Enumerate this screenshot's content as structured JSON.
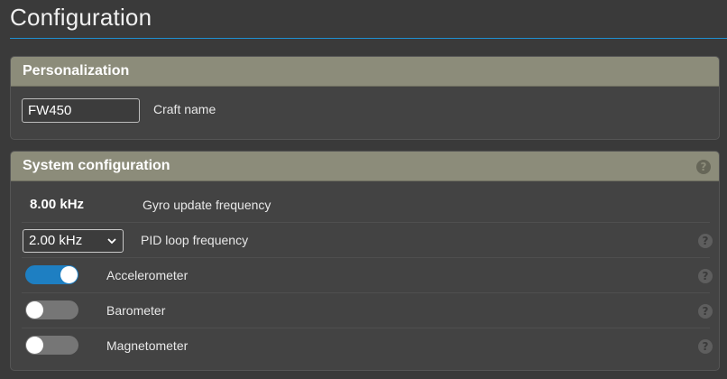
{
  "page": {
    "title": "Configuration"
  },
  "personalization": {
    "header": "Personalization",
    "craft_name_value": "FW450",
    "craft_name_label": "Craft name"
  },
  "system": {
    "header": "System configuration",
    "help_glyph": "?",
    "gyro": {
      "value": "8.00 kHz",
      "label": "Gyro update frequency"
    },
    "pid": {
      "selected": "2.00 kHz",
      "label": "PID loop frequency"
    },
    "accelerometer": {
      "label": "Accelerometer",
      "enabled": true
    },
    "barometer": {
      "label": "Barometer",
      "enabled": false
    },
    "magnetometer": {
      "label": "Magnetometer",
      "enabled": false
    }
  },
  "colors": {
    "accent": "#1e7fc2",
    "panel_header": "#8c8c7a",
    "toggle_off": "#767676"
  }
}
